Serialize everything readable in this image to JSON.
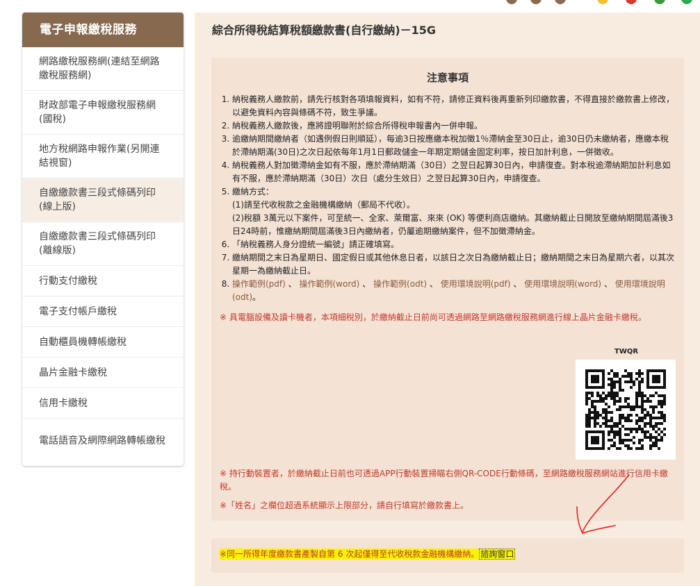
{
  "sidebar": {
    "header": "電子申報繳稅服務",
    "items": [
      {
        "label": "網路繳稅服務網(連結至網路繳稅服務網)"
      },
      {
        "label": "財政部電子申報繳稅服務網(國稅)"
      },
      {
        "label": "地方稅網路申報作業(另開連結視窗)"
      },
      {
        "label": "自繳繳款書三段式條碼列印(線上版)"
      },
      {
        "label": "自繳繳款書三段式條碼列印(離線版)"
      },
      {
        "label": "行動支付繳稅"
      },
      {
        "label": "電子支付帳戶繳稅"
      },
      {
        "label": "自動櫃員機轉帳繳稅"
      },
      {
        "label": "晶片金融卡繳稅"
      },
      {
        "label": "信用卡繳稅"
      },
      {
        "label": "電話語音及網際網路轉帳繳稅"
      }
    ]
  },
  "main": {
    "title": "綜合所得稅結算稅額繳款書(自行繳納)－15G"
  },
  "notice": {
    "title": "注意事項",
    "items": {
      "i1": "納稅義務人繳款前，請先行核對各項填報資料，如有不符，請修正資料後再重新列印繳款書，不得直接於繳款書上修改，以避免資料內容與條碼不符，致生爭議。",
      "i2": "納稅義務人繳款後，應將證明聯附於綜合所得稅申報書內一併申報。",
      "i3": "逾繳納期間繳納者（如遇例假日則順延），每逾3日按應繳本稅加徵1％滯納金至30日止，逾30日仍未繳納者，應繳本稅於滯納期滿(30日)之次日起依每年1月1日郵政儲金一年期定期儲金固定利率，按日加計利息，一併徵收。",
      "i4": "納稅義務人對加徵滯納金如有不服，應於滯納期滿（30日）之翌日起算30日內，申請復查。對本稅逾滯納期加計利息如有不服，應於滯納期滿（30日）次日（處分生效日）之翌日起算30日內，申請復查。",
      "i5": "繳納方式：",
      "i5a": "(1)請至代收稅款之金融機構繳納（郵局不代收）。",
      "i5b": "(2)稅額 3萬元以下案件，可至統一、全家、萊爾富、來來 (OK) 等便利商店繳納。其繳納截止日開放至繳納期間屆滿後3日24時前，惟繳納期間屆滿後3日內繳納者，仍屬逾期繳納案件，但不加徵滯納金。",
      "i6": "「納稅義務人身分證統一編號」請正確填寫。",
      "i7": "繳納期間之末日為星期日、國定假日或其他休息日者，以該日之次日為繳納截止日；繳納期間之末日為星期六者，以其次星期一為繳納截止日。",
      "i8links": [
        "操作範例(pdf)",
        "操作範例(word)",
        "操作範例(odt)",
        "使用環境說明(pdf)",
        "使用環境說明(word)",
        "使用環境說明(odt)"
      ],
      "sep": "、",
      "end": "。"
    },
    "card_note": "※ 具電腦設備及讀卡機者，本項細稅別，於繳納截止日前尚可透過網路至網路繳稅服務網進行線上晶片金融卡繳稅。",
    "qr_label": "TWQR",
    "mobile_note": "※ 持行動裝置者，於繳納截止日前也可透過APP行動裝置掃瞄右側QR-CODE行動條碼，至網路繳稅服務網站進行信用卡繳稅。",
    "name_note": "※「姓名」之欄位超過系統顯示上限部分，請自行填寫於繳款書上。"
  },
  "bottom": {
    "text": "※同一所得年度繳款書產製自第 6 次起僅得至代收稅款金融機構繳納。",
    "link": "諮詢窗口"
  },
  "colors": {
    "sidebar_header": "#87694f",
    "main_bg": "#f7ecdf",
    "notice_bg": "#f4e2d5",
    "red": "#c0392b",
    "highlight": "#f8f400",
    "arrow": "#e02020"
  }
}
